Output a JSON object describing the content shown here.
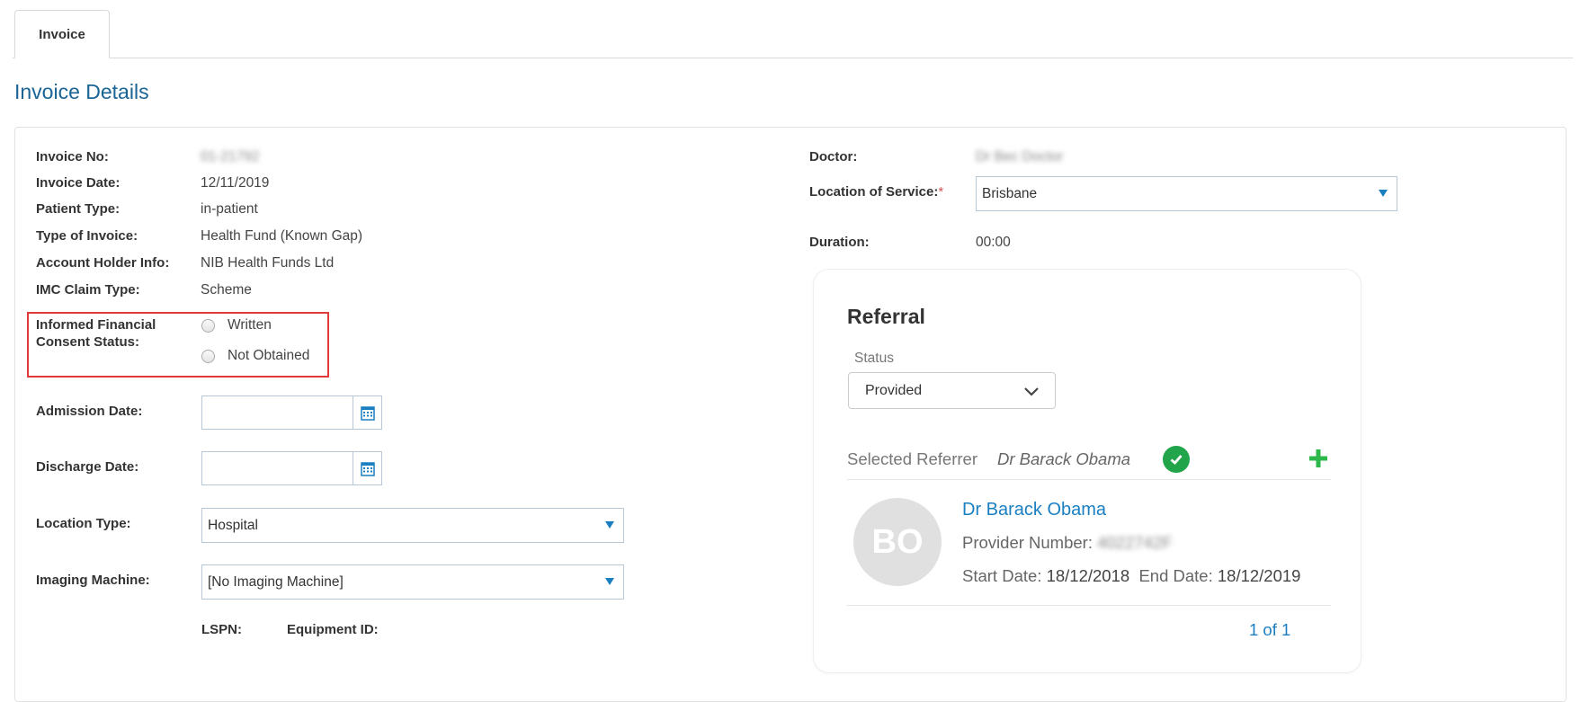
{
  "tabs": {
    "invoice": "Invoice"
  },
  "page_title": "Invoice Details",
  "left": {
    "invoice_no": {
      "label": "Invoice No:",
      "value": "01-21792"
    },
    "invoice_date": {
      "label": "Invoice Date:",
      "value": "12/11/2019"
    },
    "patient_type": {
      "label": "Patient Type:",
      "value": "in-patient"
    },
    "type_of_invoice": {
      "label": "Type of Invoice:",
      "value": "Health Fund (Known Gap)"
    },
    "account_holder": {
      "label": "Account Holder Info:",
      "value": "NIB Health Funds Ltd"
    },
    "imc_claim_type": {
      "label": "IMC Claim Type:",
      "value": "Scheme"
    },
    "ifc_status": {
      "label_line1": "Informed Financial",
      "label_line2": "Consent Status:",
      "options": [
        "Written",
        "Not Obtained"
      ]
    },
    "admission_date": {
      "label": "Admission Date:",
      "value": ""
    },
    "discharge_date": {
      "label": "Discharge Date:",
      "value": ""
    },
    "location_type": {
      "label": "Location Type:",
      "value": "Hospital"
    },
    "imaging_machine": {
      "label": "Imaging Machine:",
      "value": "[No Imaging Machine]"
    },
    "lspn_label": "LSPN:",
    "equipment_id_label": "Equipment ID:"
  },
  "right": {
    "doctor": {
      "label": "Doctor:",
      "value": "Dr Bec Doctor"
    },
    "location_of_service": {
      "label": "Location of Service:",
      "required_mark": "*",
      "value": "Brisbane"
    },
    "duration": {
      "label": "Duration:",
      "value": "00:00"
    }
  },
  "referral": {
    "title": "Referral",
    "status_label": "Status",
    "status_value": "Provided",
    "selected_referrer_label": "Selected Referrer",
    "selected_referrer_name": "Dr Barack Obama",
    "avatar_initials": "BO",
    "doctor_name": "Dr Barack Obama",
    "provider_number_label": "Provider Number:",
    "provider_number_value": "4022742F",
    "start_date_label": "Start Date:",
    "start_date_value": "18/12/2018",
    "end_date_label": "End Date:",
    "end_date_value": "18/12/2019",
    "pager": "1 of 1"
  },
  "colors": {
    "accent": "#1a7fc1",
    "title": "#1a6496",
    "highlight": "#e03a3a",
    "check": "#22a44a",
    "plus": "#2db84b"
  }
}
